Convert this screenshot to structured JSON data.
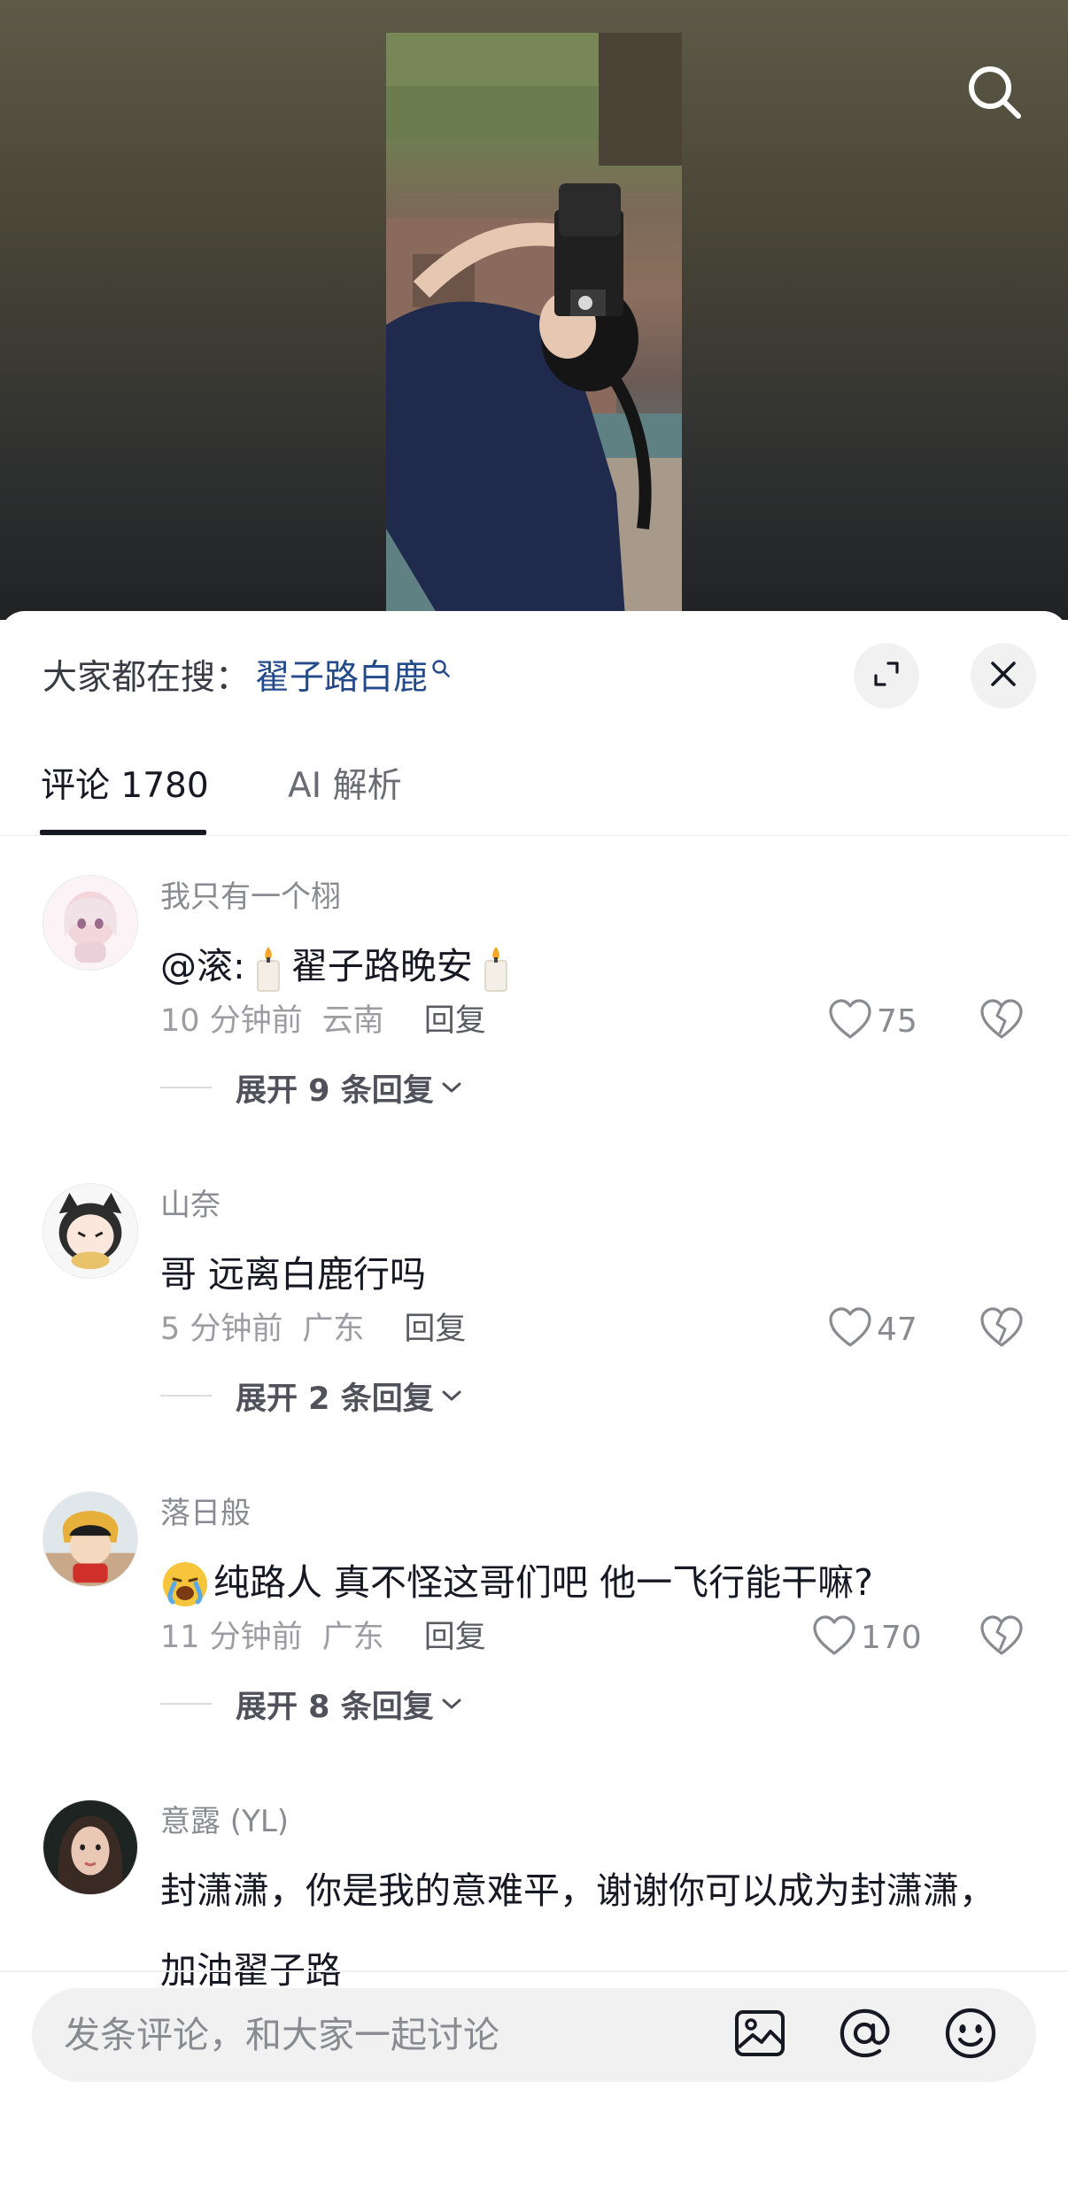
{
  "video": {
    "search_icon": "search-icon"
  },
  "panel": {
    "trending_prefix": "大家都在搜：",
    "trending_keyword": "翟子路白鹿",
    "expand_icon": "expand-icon",
    "close_icon": "close-icon"
  },
  "tabs": [
    {
      "label": "评论 1780",
      "active": true
    },
    {
      "label": "AI 解析",
      "active": false
    }
  ],
  "comments": [
    {
      "user": "我只有一个栩",
      "text_before": "@滚:",
      "text_middle": "翟子路晚安",
      "time": "10 分钟前",
      "location": "云南",
      "reply": "回复",
      "likes": "75",
      "expand": "展开 9 条回复"
    },
    {
      "user": "山奈",
      "text": "哥  远离白鹿行吗",
      "time": "5 分钟前",
      "location": "广东",
      "reply": "回复",
      "likes": "47",
      "expand": "展开 2 条回复"
    },
    {
      "user": "落日般",
      "text": "纯路人 真不怪这哥们吧 他一飞行能干嘛?",
      "time": "11 分钟前",
      "location": "广东",
      "reply": "回复",
      "likes": "170",
      "expand": "展开 8 条回复"
    },
    {
      "user": "意露 (YL)",
      "text": "封潇潇，你是我的意难平，谢谢你可以成为封潇潇，加油翟子路"
    }
  ],
  "input": {
    "placeholder": "发条评论，和大家一起讨论",
    "icons": [
      "image-icon",
      "at-icon",
      "emoji-icon"
    ]
  },
  "colors": {
    "keyword": "#234a8a",
    "text_primary": "#161823",
    "text_secondary": "#8a8b91",
    "input_bg": "#f1f1f2"
  }
}
